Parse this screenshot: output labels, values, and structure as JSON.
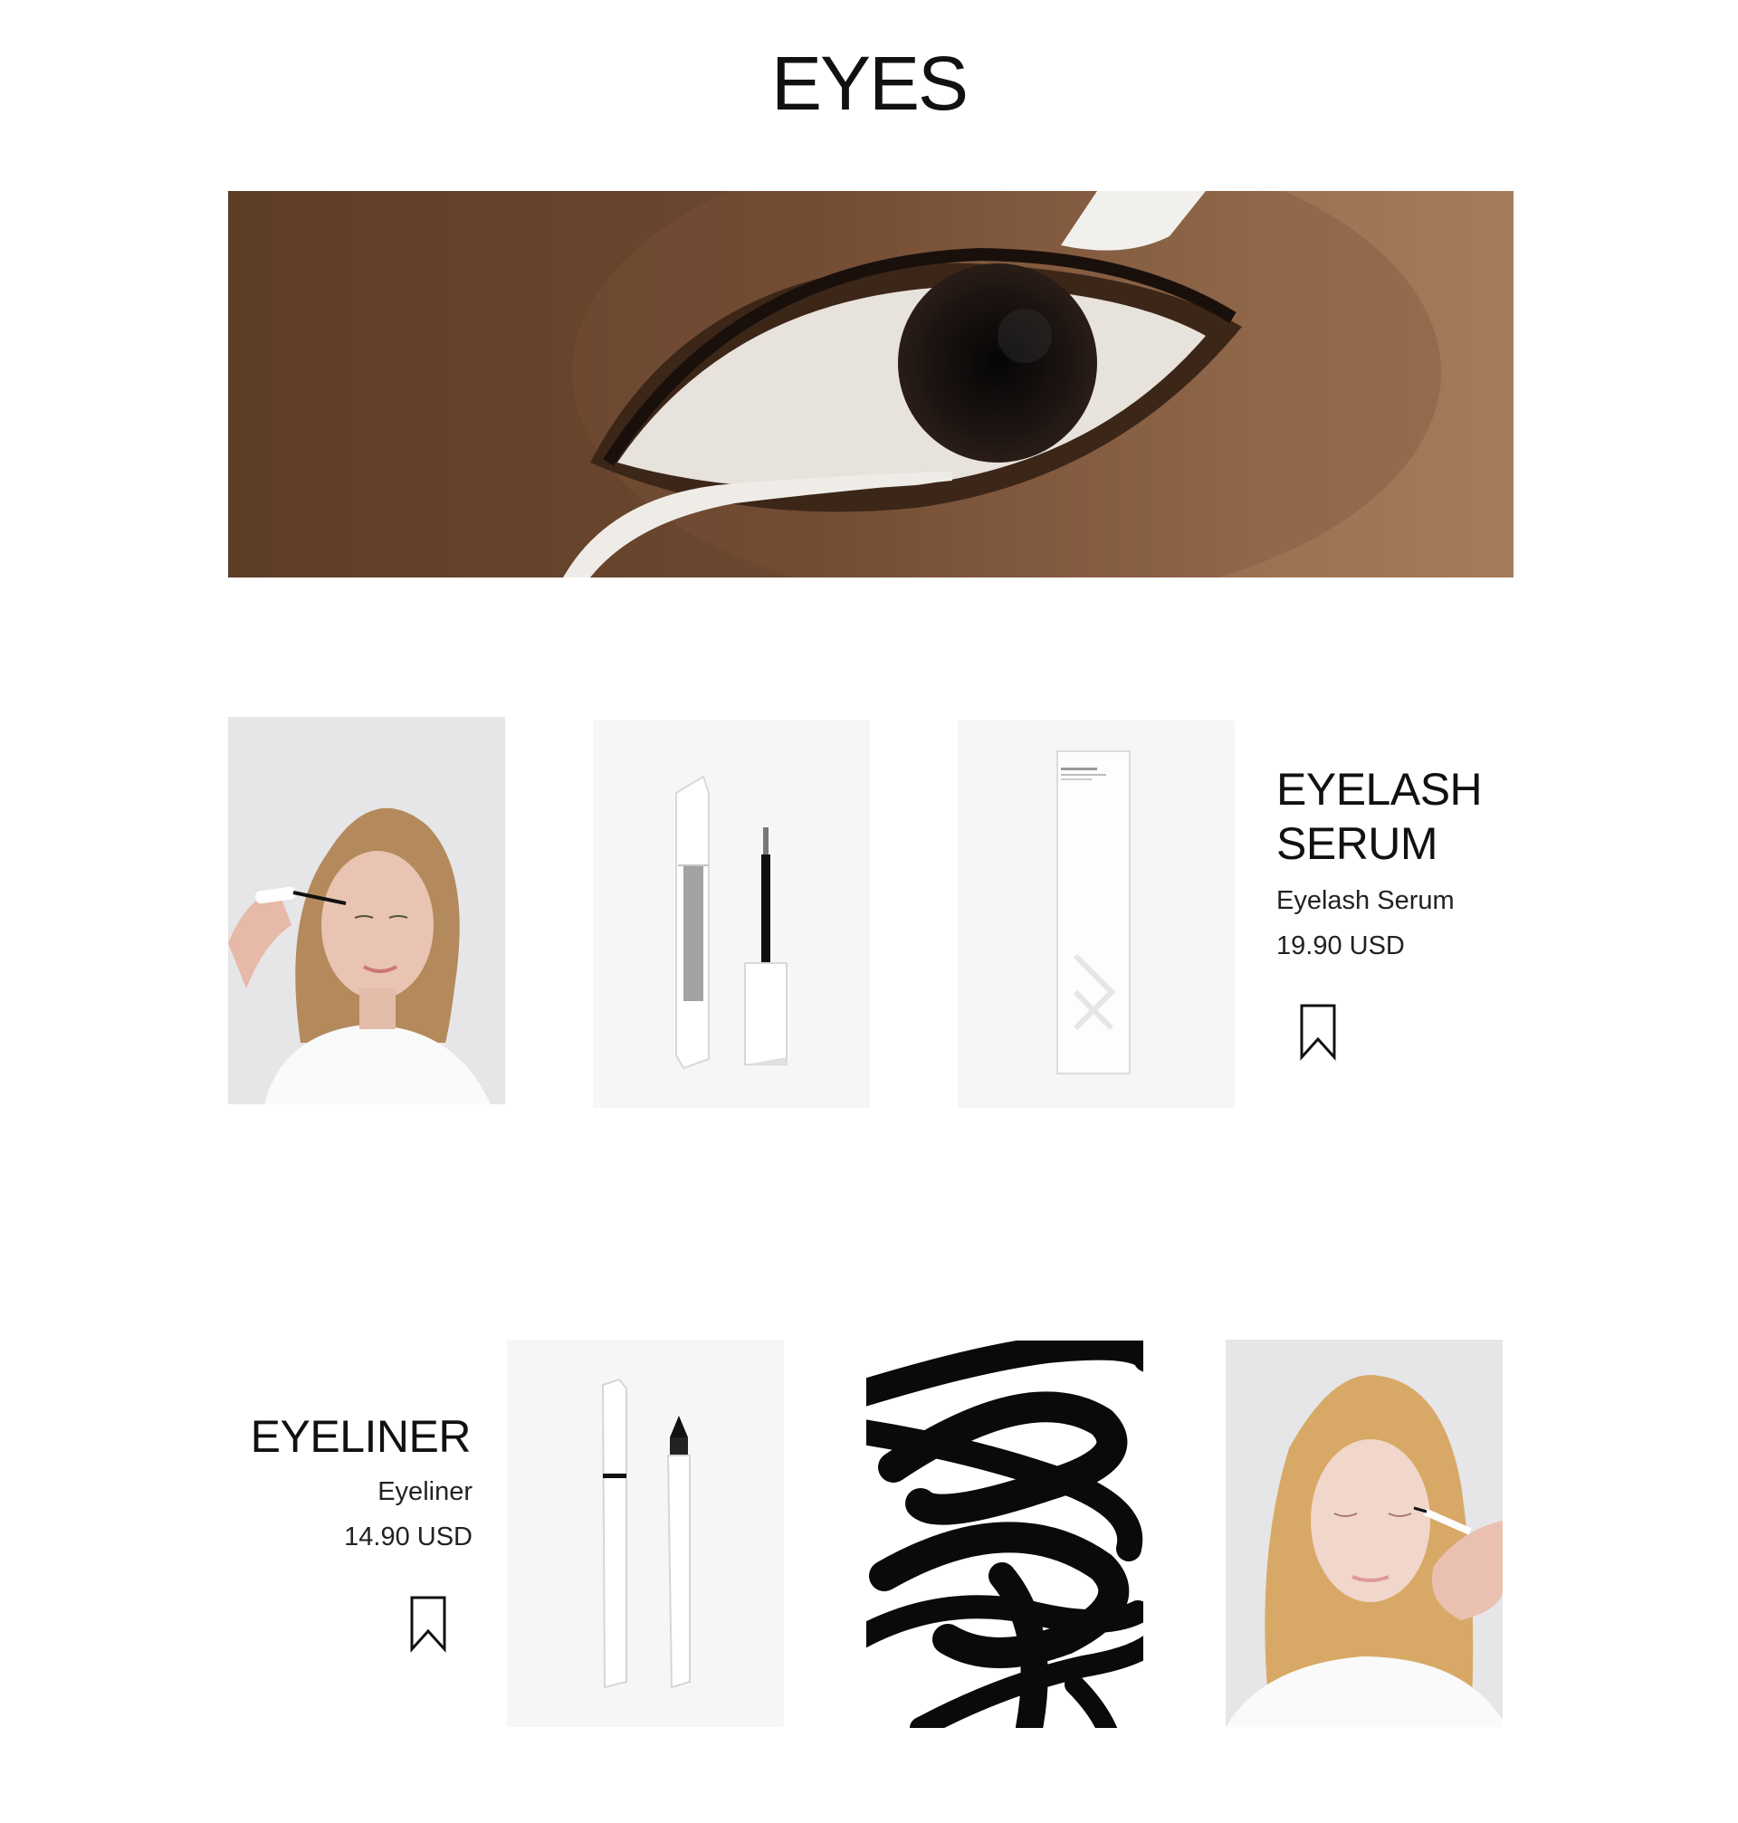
{
  "page": {
    "title": "EYES"
  },
  "hero": {
    "image": "eye-closeup-with-white-liner"
  },
  "products": [
    {
      "heading_line1": "EYELASH",
      "heading_line2": "SERUM",
      "name": "Eyelash Serum",
      "price": "19.90 USD",
      "images": [
        "model-applying-serum",
        "serum-tube-and-wand",
        "serum-box"
      ],
      "save_icon": "bookmark-icon"
    },
    {
      "heading": "EYELINER",
      "name": "Eyeliner",
      "price": "14.90 USD",
      "images": [
        "eyeliner-pen",
        "black-brush-strokes",
        "model-applying-eyeliner"
      ],
      "save_icon": "bookmark-icon"
    }
  ],
  "colors": {
    "text": "#111111",
    "image_bg": "#f6f6f6",
    "skin_dark": "#7a5236",
    "liner_black": "#0a0a0a"
  }
}
